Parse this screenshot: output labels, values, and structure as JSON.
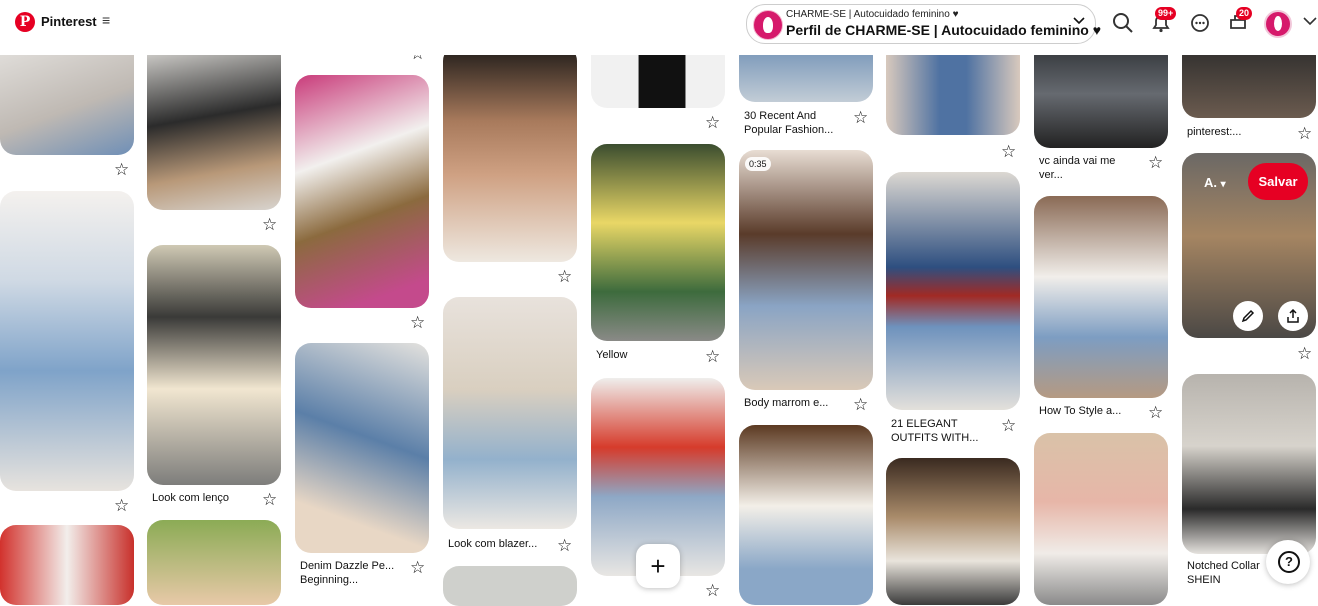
{
  "header": {
    "brand": "Pinterest",
    "menu_icon": "hamburger-icon",
    "profile_small": "CHARME-SE | Autocuidado feminino ♥",
    "profile_name": "Perfil de CHARME-SE | Autocuidado feminino ♥",
    "notifications_badge": "99+",
    "updates_badge": "20"
  },
  "pins": [
    {
      "title": ""
    },
    {
      "title": ""
    },
    {
      "title": ""
    },
    {
      "title": ""
    },
    {
      "title": "Look com lenço"
    },
    {
      "title": ""
    },
    {
      "title": ""
    },
    {
      "title": ""
    },
    {
      "title": "Denim Dazzle Pe... Beginning..."
    },
    {
      "title": ""
    },
    {
      "title": "Look com blazer..."
    },
    {
      "title": ""
    },
    {
      "title": ""
    },
    {
      "title": "Yellow"
    },
    {
      "title": ""
    },
    {
      "title": "30 Recent And Popular Fashion..."
    },
    {
      "title": "Body marrom e..."
    },
    {
      "title": ""
    },
    {
      "title": ""
    },
    {
      "title": "21 ELEGANT OUTFITS WITH..."
    },
    {
      "title": ""
    },
    {
      "title": "vc ainda vai me ver..."
    },
    {
      "title": "How To Style a..."
    },
    {
      "title": ""
    },
    {
      "title": "pinterest:..."
    },
    {
      "title": ""
    },
    {
      "title": "Notched Collar SHEIN"
    }
  ],
  "overlay": {
    "board_label": "A.",
    "save_label": "Salvar",
    "video_duration": "0:35"
  },
  "fab": {
    "plus": "+"
  },
  "help": {
    "label": "?"
  }
}
